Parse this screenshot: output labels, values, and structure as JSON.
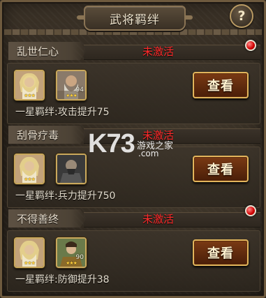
{
  "header": {
    "title": "武将羁绊",
    "help_label": "?"
  },
  "colors": {
    "status": "#ff2a2a",
    "accent": "#e2b55c",
    "button": "#5e2a0e"
  },
  "bonds": [
    {
      "name": "乱世仁心",
      "status": "未激活",
      "has_alert_dot": true,
      "effect": "一星羁绊:攻击提升75",
      "button_label": "查看",
      "portraits": [
        {
          "name": "hero-portrait-blonde-elder",
          "stars": "★★★",
          "level": ""
        },
        {
          "name": "hero-portrait-gray-beard",
          "stars": "★★★",
          "level": "94"
        }
      ]
    },
    {
      "name": "刮骨疗毒",
      "status": "未激活",
      "has_alert_dot": false,
      "effect": "一星羁绊:兵力提升750",
      "button_label": "查看",
      "portraits": [
        {
          "name": "hero-portrait-blonde-elder",
          "stars": "★★★",
          "level": ""
        },
        {
          "name": "hero-portrait-dark-warrior",
          "stars": "",
          "level": ""
        }
      ]
    },
    {
      "name": "不得善终",
      "status": "未激活",
      "has_alert_dot": true,
      "effect": "一星羁绊:防御提升38",
      "button_label": "查看",
      "portraits": [
        {
          "name": "hero-portrait-blonde-elder",
          "stars": "★★★",
          "level": ""
        },
        {
          "name": "hero-portrait-young-general",
          "stars": "★★★",
          "level": "90"
        }
      ]
    }
  ],
  "watermark": {
    "logo": "K73",
    "site": "游戏之家",
    "domain": ".com"
  }
}
